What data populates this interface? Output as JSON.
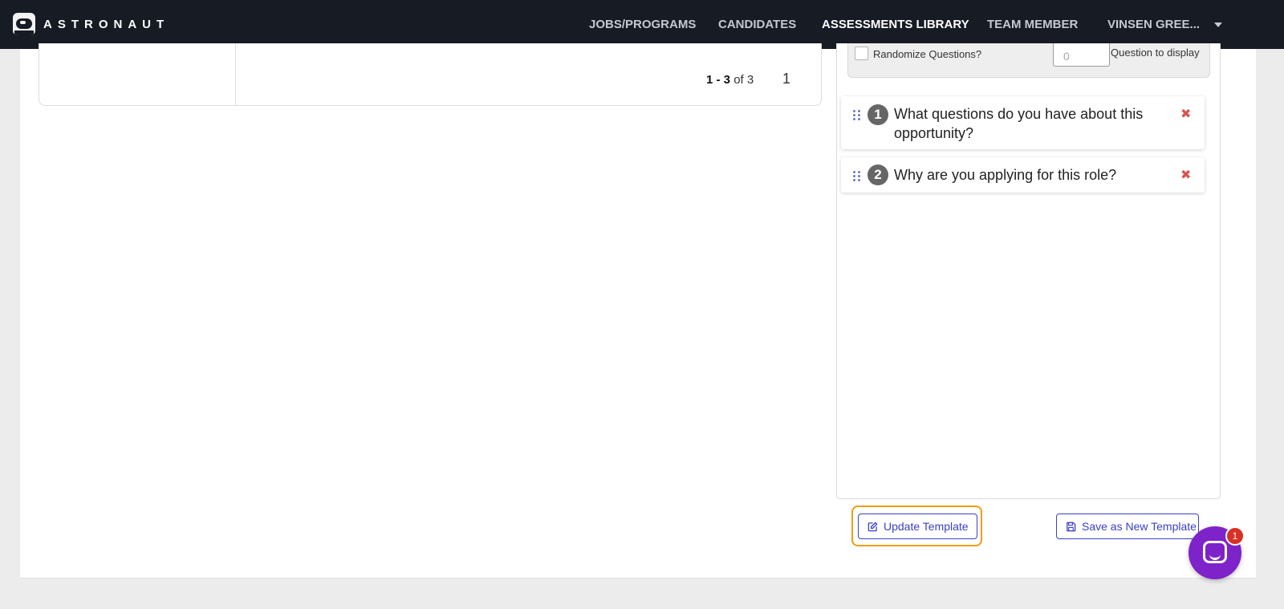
{
  "brand": {
    "name": "ASTRONAUT"
  },
  "nav": {
    "jobs": "JOBS/PROGRAMS",
    "candidates": "CANDIDATES",
    "assessments": "ASSESSMENTS LIBRARY",
    "team": "TEAM MEMBER",
    "user": "VINSEN GREE..."
  },
  "pagination": {
    "range": "1 - 3",
    "of_text": "of 3",
    "page": "1"
  },
  "settings": {
    "randomize_label": "Randomize Questions?",
    "display_value": "0",
    "display_label": "Question to display"
  },
  "questions": [
    {
      "number": "1",
      "text": "What questions do you have about this opportunity?"
    },
    {
      "number": "2",
      "text": "Why are you applying for this role?"
    }
  ],
  "actions": {
    "update": "Update Template",
    "save_new": "Save as New Template"
  },
  "chat": {
    "badge_count": "1"
  },
  "colors": {
    "accent": "#3b40c4",
    "focus": "#f39c12",
    "delete": "#d9534f",
    "chat": "#7e22c9",
    "topbar": "#161b24"
  }
}
